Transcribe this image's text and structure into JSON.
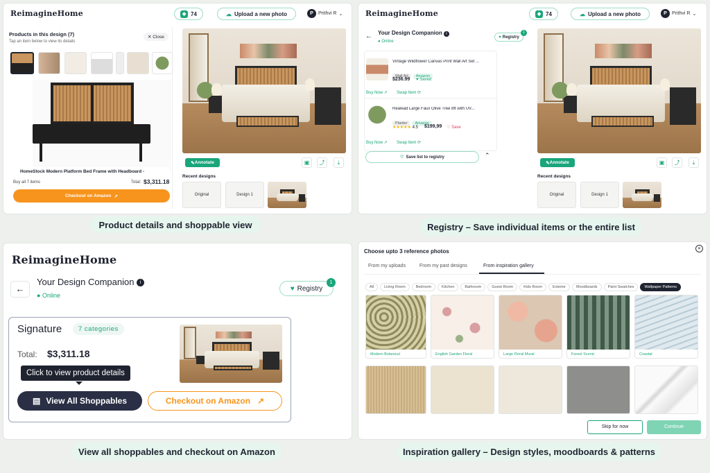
{
  "panel1": {
    "logo": "ReimagineHome",
    "credits": "74",
    "upload_label": "Upload a new photo",
    "user_initial": "P",
    "user_name": "Prithvi R",
    "products_title": "Products in this design (7)",
    "products_hint": "Tap an item below to view its details",
    "close_label": "Close",
    "product_name": "HomeStock Modern Platform Bed Frame with Headboard -",
    "buy_all": "Buy all 7 items",
    "total_label": "Total:",
    "total_value": "$3,311.18",
    "checkout_label": "Checkout on Amazon",
    "annotate_label": "Annotate",
    "recent_title": "Recent designs",
    "recent": [
      "Original",
      "Design 1"
    ],
    "caption": "Product details and shoppable view"
  },
  "panel2": {
    "logo": "ReimagineHome",
    "credits": "74",
    "upload_label": "Upload a new photo",
    "user_initial": "P",
    "user_name": "Prithvi R",
    "companion_title": "Your Design Companion",
    "online": "Online",
    "registry_label": "Registry",
    "registry_count": "1",
    "items": [
      {
        "name": "Vintage Wildflower Canvas Print Wall Art Set ...",
        "tags": [
          "Wall Art",
          "Amazon"
        ],
        "price": "$236.99",
        "status": "Saved",
        "rating": "",
        "buy": "Buy Now",
        "swap": "Swap Item"
      },
      {
        "name": "Realead Large Faux Olive Tree 8ft with UV...",
        "tags": [
          "Planter",
          "Amazon"
        ],
        "price": "$199,99",
        "status": "Save",
        "rating": "4.5",
        "buy": "Buy Now",
        "swap": "Swap Item"
      }
    ],
    "save_list_label": "Save list to registry",
    "annotate_label": "Annotate",
    "recent_title": "Recent designs",
    "recent": [
      "Original",
      "Design 1"
    ],
    "caption": "Registry – Save individual items or the entire list"
  },
  "panel3": {
    "logo": "ReimagineHome",
    "companion_title": "Your Design Companion",
    "online": "Online",
    "registry_label": "Registry",
    "registry_count": "1",
    "signature_title": "Signature",
    "categories_label": "7 categories",
    "total_label": "Total:",
    "total_value": "$3,311.18",
    "tooltip": "Click to view product details",
    "view_all_label": "View All Shoppables",
    "checkout_label": "Checkout on Amazon",
    "caption": "View all shoppables and checkout on Amazon"
  },
  "panel4": {
    "title": "Choose upto 3 reference photos",
    "tabs": [
      "From my uploads",
      "From my past designs",
      "From inspiration gallery"
    ],
    "filters": [
      "All",
      "Living Room",
      "Bedroom",
      "Kitchen",
      "Bathroom",
      "Guest Room",
      "Kids Room",
      "Exterior",
      "Moodboards",
      "Paint Swatches",
      "Wallpaper Patterns"
    ],
    "patterns": [
      "Modern Botanical",
      "English Garden Floral",
      "Large Floral Mural",
      "Forest Scenic",
      "Coastal"
    ],
    "skip_label": "Skip for now",
    "continue_label": "Continue",
    "caption": "Inspiration gallery – Design styles, moodboards & patterns"
  },
  "colors": {
    "accent": "#1aa67a",
    "amazon": "#f7941d",
    "dark": "#2a2f45",
    "caption_bg": "#e6f6ee"
  },
  "icons": [
    "gem-icon",
    "upload-icon",
    "chevron-down-icon",
    "close-icon",
    "external-link-icon",
    "back-arrow-icon",
    "info-icon",
    "heart-icon",
    "store-icon",
    "share-icon",
    "download-icon"
  ]
}
